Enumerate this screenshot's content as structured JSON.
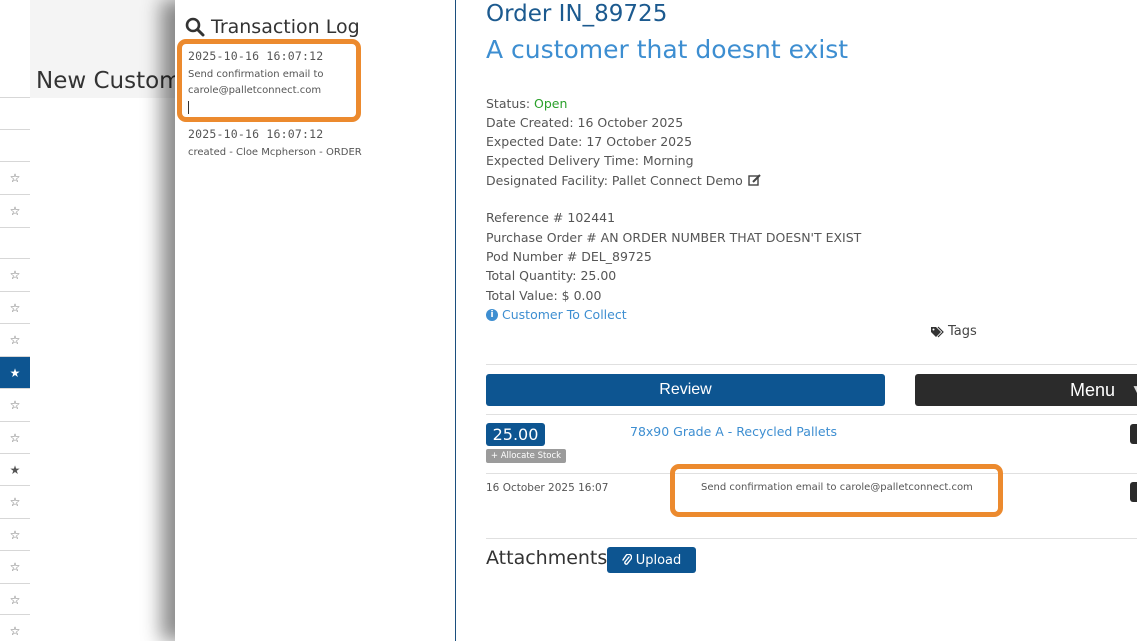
{
  "background": {
    "page_title": "New Custom",
    "star_rows": [
      "☆",
      "☆",
      "☆",
      "☆",
      "☆",
      "★",
      "☆",
      "☆",
      "★",
      "☆",
      "☆",
      "☆",
      "☆",
      "☆"
    ]
  },
  "transaction_log": {
    "title": "Transaction Log",
    "entries": [
      {
        "time": "2025-10-16 16:07:12",
        "text": "Send confirmation email to carole@palletconnect.com"
      },
      {
        "time": "2025-10-16 16:07:12",
        "text": "created - Cloe Mcpherson - ORDER"
      }
    ]
  },
  "order": {
    "title": "Order IN_89725",
    "customer": "A customer that doesnt exist",
    "status_label": "Status:",
    "status_value": "Open",
    "date_created": "Date Created: 16 October 2025",
    "expected_date": "Expected Date: 17 October 2025",
    "expected_delivery_time": "Expected Delivery Time: Morning",
    "facility": "Designated Facility: Pallet Connect Demo",
    "reference": "Reference # 102441",
    "purchase_order": "Purchase Order # AN ORDER NUMBER THAT DOESN'T EXIST",
    "pod_number": "Pod Number # DEL_89725",
    "total_quantity": "Total Quantity: 25.00",
    "total_value": "Total Value: $ 0.00",
    "customer_to_collect": "Customer To Collect",
    "tags_label": "Tags",
    "review_label": "Review",
    "menu_label": "Menu",
    "line_item": {
      "quantity": "25.00",
      "allocate_label": "+ Allocate Stock",
      "product": "78x90 Grade A - Recycled Pallets"
    },
    "note": {
      "date": "16 October 2025 16:07",
      "text": "Send confirmation email to carole@palletconnect.com"
    },
    "attachments_title": "Attachments",
    "upload_label": "Upload"
  },
  "colors": {
    "primary": "#0d5591",
    "link": "#3d8ed1",
    "status_open": "#2aa02a",
    "highlight": "#ec8a2e"
  }
}
